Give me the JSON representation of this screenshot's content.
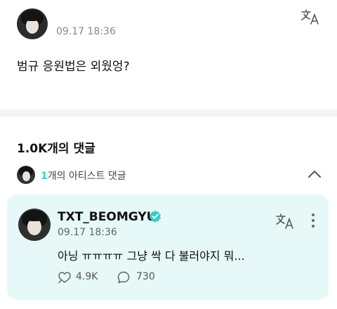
{
  "post": {
    "timestamp": "09.17 18:36",
    "body": "범규 응원법은 외웠엉?"
  },
  "comments": {
    "count_label": "1.0K개의 댓글",
    "artist_count": "1",
    "artist_label": "개의 아티스트 댓글"
  },
  "artist_comment": {
    "author": "TXT_BEOMGYU",
    "timestamp": "09.17 18:36",
    "body": "아닝 ㅠㅠㅠㅠ 그냥 싹 다 불러야지 뭐...",
    "likes": "4.9K",
    "replies": "730"
  },
  "icons": {
    "translate": "translate-icon",
    "verified": "verified-badge-icon",
    "more": "more-vertical-icon",
    "like": "like-icon",
    "reply": "reply-icon",
    "collapse": "chevron-up-icon"
  },
  "colors": {
    "accent": "#3fc7c7",
    "card_background": "#e6f8f7",
    "verified": "#3fc7c7",
    "muted_text": "#888888"
  }
}
